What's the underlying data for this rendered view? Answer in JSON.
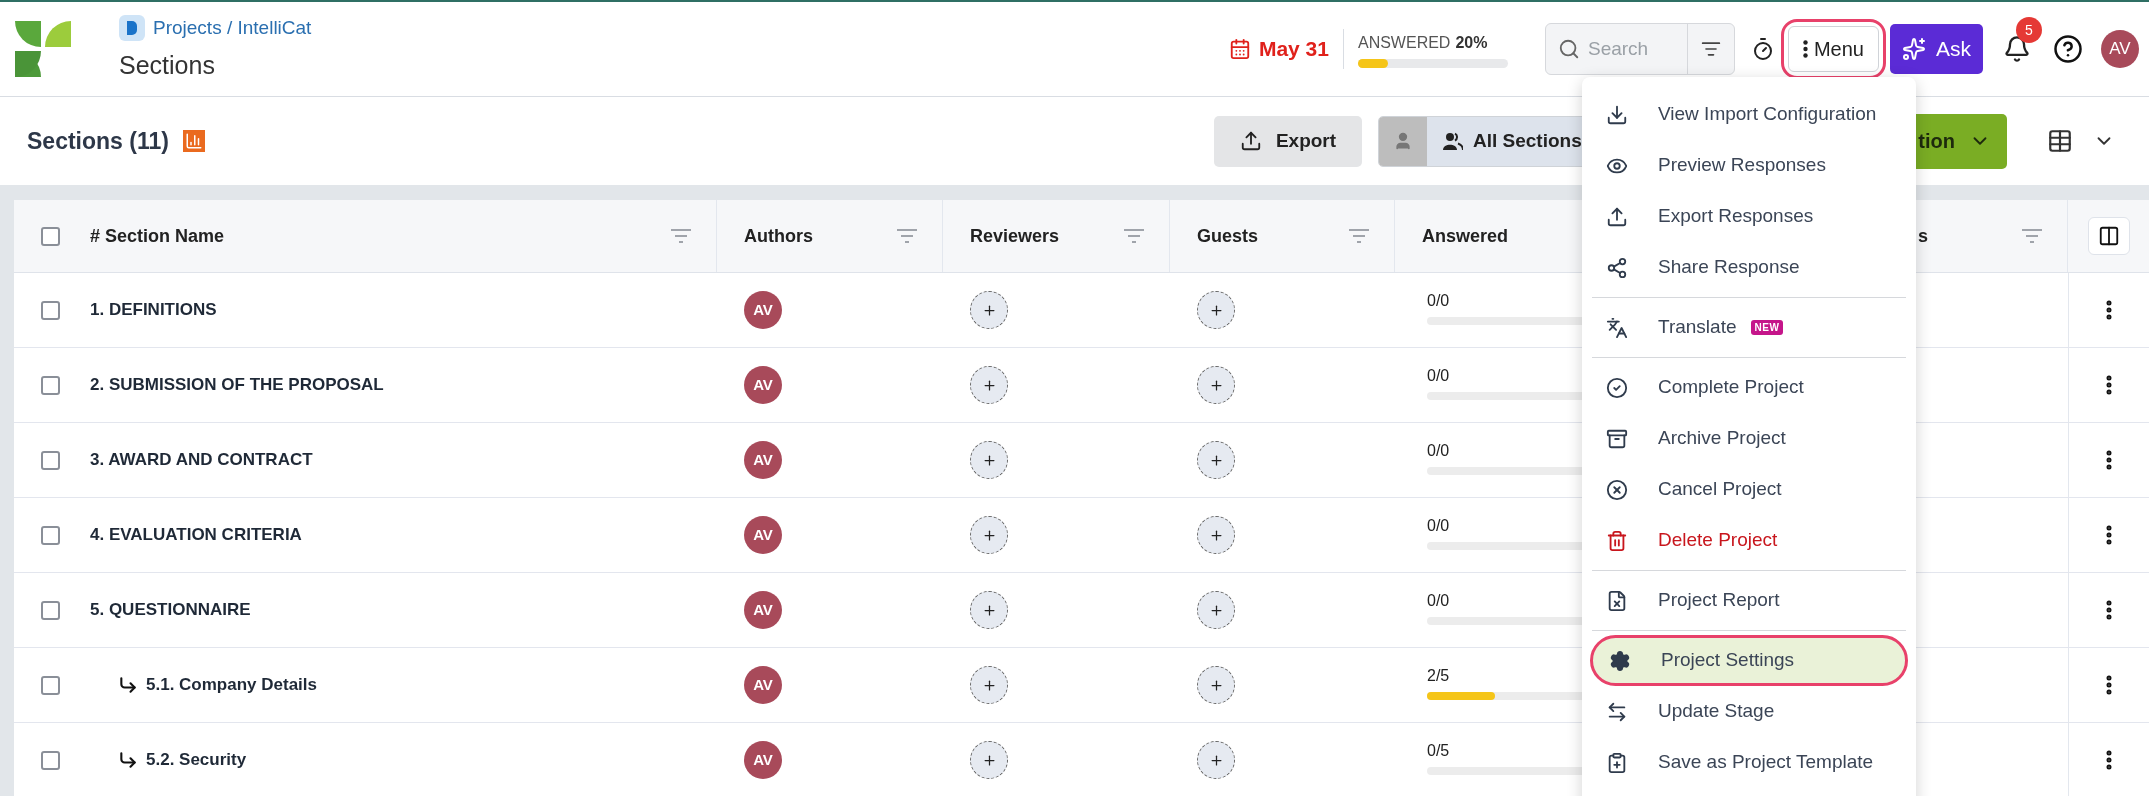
{
  "header": {
    "breadcrumb": "Projects / IntelliCat",
    "title": "Sections",
    "due_date": "May 31",
    "answered": {
      "label": "ANSWERED",
      "value": "20%",
      "level": 0.2
    },
    "search": {
      "placeholder": "Search"
    },
    "menu_button": {
      "label": "Menu",
      "outlined": true
    },
    "ask_button": "Ask",
    "notifications": {
      "count": "5"
    },
    "avatar": "AV"
  },
  "toolbar": {
    "title": "Sections (11)",
    "export_button": "Export",
    "view_switch": [
      {
        "kind": "mine",
        "selected": false
      },
      {
        "kind": "all",
        "label": "All Sections",
        "selected": true
      }
    ],
    "action_button": "tion"
  },
  "table": {
    "columns": [
      {
        "label": "# Section Name"
      },
      {
        "label": "Authors"
      },
      {
        "label": "Reviewers"
      },
      {
        "label": "Guests"
      },
      {
        "label": "Answered"
      },
      {
        "label": "s"
      }
    ],
    "header_checkbox": {
      "checked": false
    },
    "rows": [
      {
        "name": "1. DEFINITIONS",
        "checked": false,
        "author": "AV",
        "answered": "0/0",
        "level": 0
      },
      {
        "name": "2. SUBMISSION OF THE PROPOSAL",
        "checked": false,
        "author": "AV",
        "answered": "0/0",
        "level": 0
      },
      {
        "name": "3. AWARD AND CONTRACT",
        "checked": false,
        "author": "AV",
        "answered": "0/0",
        "level": 0
      },
      {
        "name": "4. EVALUATION CRITERIA",
        "checked": false,
        "author": "AV",
        "answered": "0/0",
        "level": 0
      },
      {
        "name": "5. QUESTIONNAIRE",
        "checked": false,
        "author": "AV",
        "answered": "0/0",
        "level": 0,
        "children": [
          {
            "name": "5.1. Company Details",
            "checked": false,
            "author": "AV",
            "answered": "2/5",
            "level": 0.4
          },
          {
            "name": "5.2. Security",
            "checked": false,
            "author": "AV",
            "answered": "0/5",
            "level": 0
          }
        ]
      }
    ]
  },
  "menu": {
    "groups": [
      [
        {
          "label": "View Import Configuration",
          "kind": "normal",
          "selected": false
        },
        {
          "label": "Preview Responses",
          "kind": "normal",
          "selected": false
        },
        {
          "label": "Export Responses",
          "kind": "normal",
          "selected": false
        },
        {
          "label": "Share Response",
          "kind": "normal",
          "selected": false
        }
      ],
      [
        {
          "label": "Translate",
          "kind": "normal",
          "selected": false,
          "badge": "NEW"
        }
      ],
      [
        {
          "label": "Complete Project",
          "kind": "normal",
          "selected": false
        },
        {
          "label": "Archive Project",
          "kind": "normal",
          "selected": false
        },
        {
          "label": "Cancel Project",
          "kind": "normal",
          "selected": false
        },
        {
          "label": "Delete Project",
          "kind": "danger",
          "selected": false
        }
      ],
      [
        {
          "label": "Project Report",
          "kind": "normal",
          "selected": false
        }
      ],
      [
        {
          "label": "Project Settings",
          "kind": "normal",
          "selected": true
        },
        {
          "label": "Update Stage",
          "kind": "normal",
          "selected": false
        },
        {
          "label": "Save as Project Template",
          "kind": "normal",
          "selected": false
        }
      ]
    ]
  }
}
